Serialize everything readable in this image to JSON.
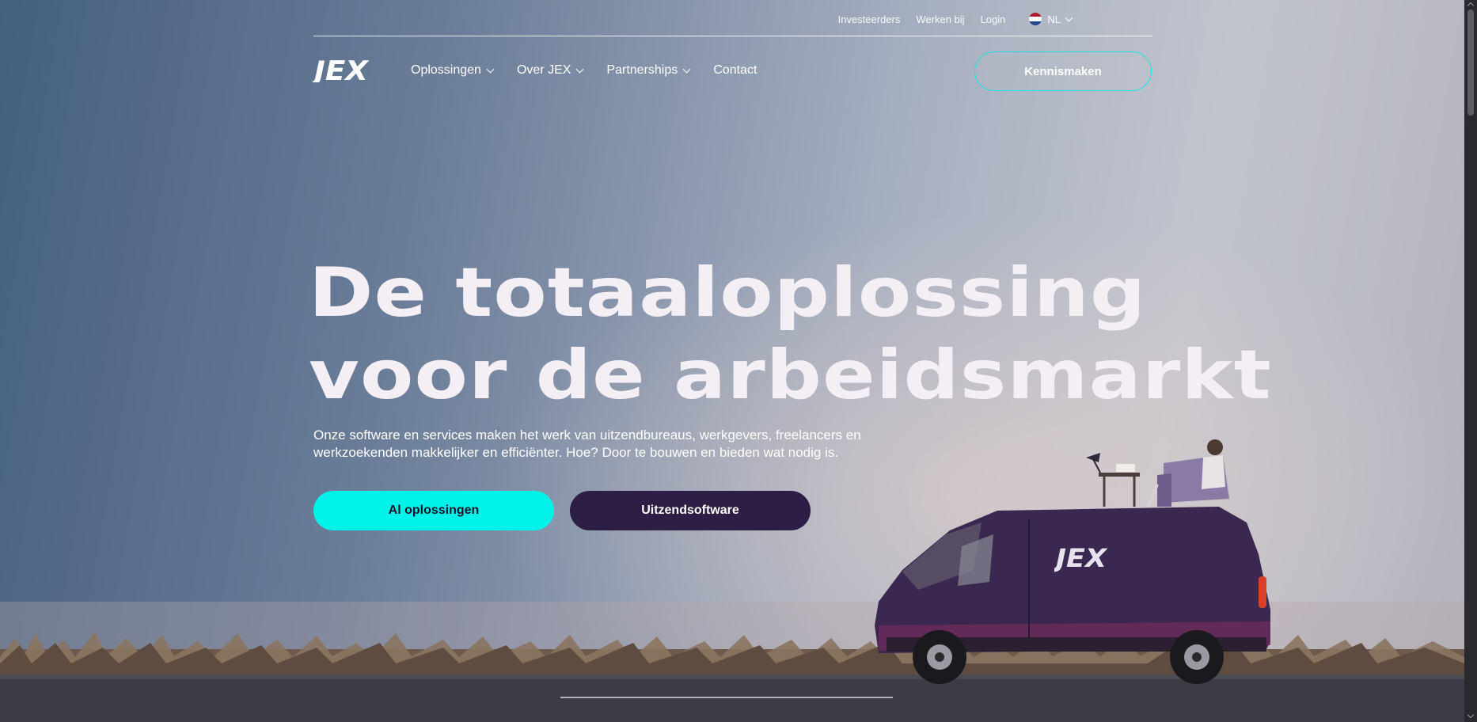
{
  "utility_nav": {
    "links": [
      "Investeerders",
      "Werken bij",
      "Login"
    ],
    "language": "NL"
  },
  "brand": {
    "logo_text": "JEX"
  },
  "main_nav": {
    "items": [
      {
        "label": "Oplossingen",
        "has_dropdown": true
      },
      {
        "label": "Over JEX",
        "has_dropdown": true
      },
      {
        "label": "Partnerships",
        "has_dropdown": true
      },
      {
        "label": "Contact",
        "has_dropdown": false
      }
    ],
    "cta_label": "Kennismaken"
  },
  "hero": {
    "headline_line1": "De totaaloplossing",
    "headline_line2": "voor de arbeidsmarkt",
    "subtext_line1": "Onze software en services maken het werk van uitzendbureaus, werkgevers, freelancers en",
    "subtext_line2": "werkzoekenden makkelijker en efficiënter. Hoe? Door te bouwen en bieden wat nodig is.",
    "primary_button": "Al oplossingen",
    "secondary_button": "Uitzendsoftware",
    "van_logo_text": "JEX"
  },
  "colors": {
    "accent_cyan": "#00f2e8",
    "dark_purple": "#2c1e44",
    "van_purple": "#3a2850"
  }
}
